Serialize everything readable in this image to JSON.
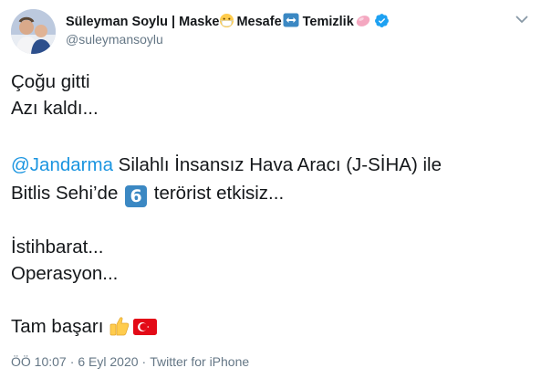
{
  "tweet": {
    "author": {
      "name_parts": [
        "Süleyman Soylu | Maske",
        "Mesafe",
        "Temizlik"
      ],
      "handle": "@suleymansoylu"
    },
    "lines": {
      "l1": "Çoğu gitti",
      "l2": "Azı kaldı...",
      "mention": "@Jandarma",
      "l3_rest": " Silahlı İnsansız Hava Aracı (J-SİHA) ile",
      "l4_pre": "Bitlis Sehi’de ",
      "l4_num": "6",
      "l4_post": " terörist etkisiz...",
      "l5": "İstihbarat...",
      "l6": "Operasyon...",
      "l7": "Tam başarı "
    },
    "meta": {
      "time": "ÖÖ 10:07",
      "dot1": "·",
      "date": "6 Eyl 2020",
      "dot2": "·",
      "source": "Twitter for iPhone"
    },
    "icons": {
      "mask": "face-with-medical-mask-icon",
      "arrows": "left-right-arrow-icon",
      "soap": "soap-icon",
      "verified": "verified-badge-icon",
      "thumbs": "thumbs-up-icon",
      "flag": "turkey-flag-icon",
      "caret": "chevron-down-icon"
    },
    "colors": {
      "link": "#1b95e0",
      "secondary": "#657786",
      "verified": "#1da1f2",
      "keycap": "#3b88c3",
      "flag": "#e30a17"
    }
  }
}
